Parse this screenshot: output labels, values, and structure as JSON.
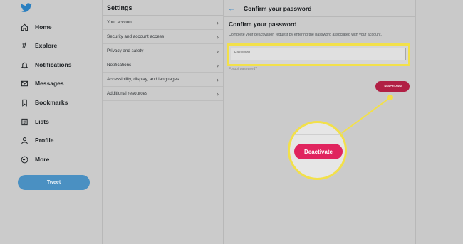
{
  "sidebar": {
    "logo_icon": "twitter-bird-icon",
    "items": [
      {
        "label": "Home",
        "icon": "home-icon"
      },
      {
        "label": "Explore",
        "icon": "hashtag-icon"
      },
      {
        "label": "Notifications",
        "icon": "bell-icon"
      },
      {
        "label": "Messages",
        "icon": "envelope-icon"
      },
      {
        "label": "Bookmarks",
        "icon": "bookmark-icon"
      },
      {
        "label": "Lists",
        "icon": "list-icon"
      },
      {
        "label": "Profile",
        "icon": "person-icon"
      },
      {
        "label": "More",
        "icon": "more-icon"
      }
    ],
    "tweet_label": "Tweet"
  },
  "settings": {
    "title": "Settings",
    "items": [
      {
        "label": "Your account"
      },
      {
        "label": "Security and account access"
      },
      {
        "label": "Privacy and safety"
      },
      {
        "label": "Notifications"
      },
      {
        "label": "Accessibility, display, and languages"
      },
      {
        "label": "Additional resources"
      }
    ]
  },
  "confirm": {
    "header_title": "Confirm your password",
    "title": "Confirm your password",
    "description": "Complete your deactivation request by entering the password associated with your account.",
    "password_placeholder": "Password",
    "forgot_label": "Forgot password?",
    "deactivate_label": "Deactivate"
  },
  "callout": {
    "deactivate_label": "Deactivate",
    "highlight_color": "#f2e04a"
  },
  "colors": {
    "accent": "#1da1f2",
    "deactivate": "#e0245e"
  }
}
